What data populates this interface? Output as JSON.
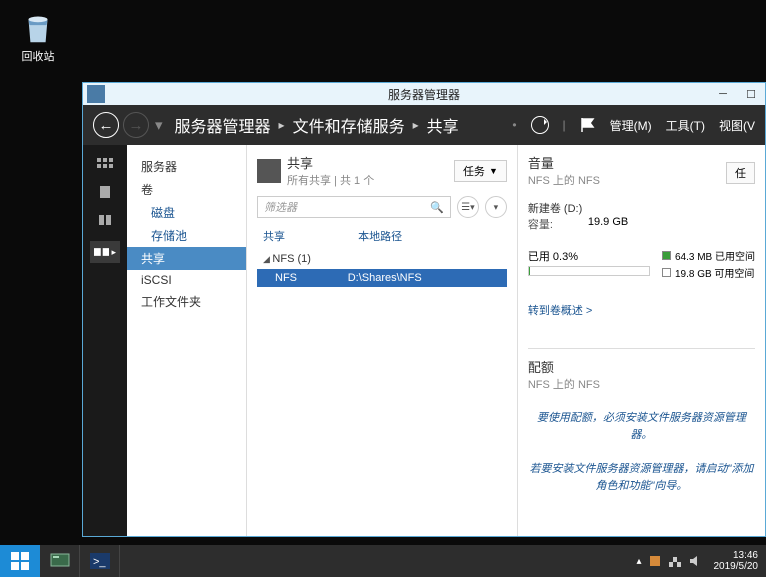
{
  "desktop": {
    "recycle_label": "回收站"
  },
  "window": {
    "title": "服务器管理器",
    "breadcrumb": [
      "服务器管理器",
      "文件和存储服务",
      "共享"
    ],
    "menu": {
      "manage": "管理(M)",
      "tools": "工具(T)",
      "view": "视图(V"
    }
  },
  "sidebar": {
    "items": [
      {
        "label": "服务器",
        "type": "header"
      },
      {
        "label": "卷",
        "type": "header"
      },
      {
        "label": "磁盘",
        "type": "sub"
      },
      {
        "label": "存储池",
        "type": "sub"
      },
      {
        "label": "共享",
        "type": "header",
        "selected": true
      },
      {
        "label": "iSCSI",
        "type": "header"
      },
      {
        "label": "工作文件夹",
        "type": "header"
      }
    ]
  },
  "shares": {
    "title": "共享",
    "subtitle": "所有共享 | 共 1 个",
    "tasks_label": "任务",
    "filter_placeholder": "筛选器",
    "columns": {
      "share": "共享",
      "path": "本地路径"
    },
    "group": "NFS (1)",
    "rows": [
      {
        "name": "NFS",
        "path": "D:\\Shares\\NFS",
        "selected": true
      }
    ]
  },
  "volume": {
    "title": "音量",
    "subtitle": "NFS 上的 NFS",
    "tasks_label": "任",
    "name": "新建卷 (D:)",
    "capacity_label": "容量:",
    "capacity": "19.9 GB",
    "used_label": "已用 0.3%",
    "legend_used": "64.3 MB 已用空间",
    "legend_free": "19.8 GB 可用空间",
    "link": "转到卷概述 >"
  },
  "quota": {
    "title": "配额",
    "subtitle": "NFS 上的 NFS",
    "msg1": "要使用配额，必须安装文件服务器资源管理器。",
    "msg2": "若要安装文件服务器资源管理器，请启动\"添加角色和功能\"向导。"
  },
  "taskbar": {
    "time": "13:46",
    "date": "2019/5/20"
  }
}
